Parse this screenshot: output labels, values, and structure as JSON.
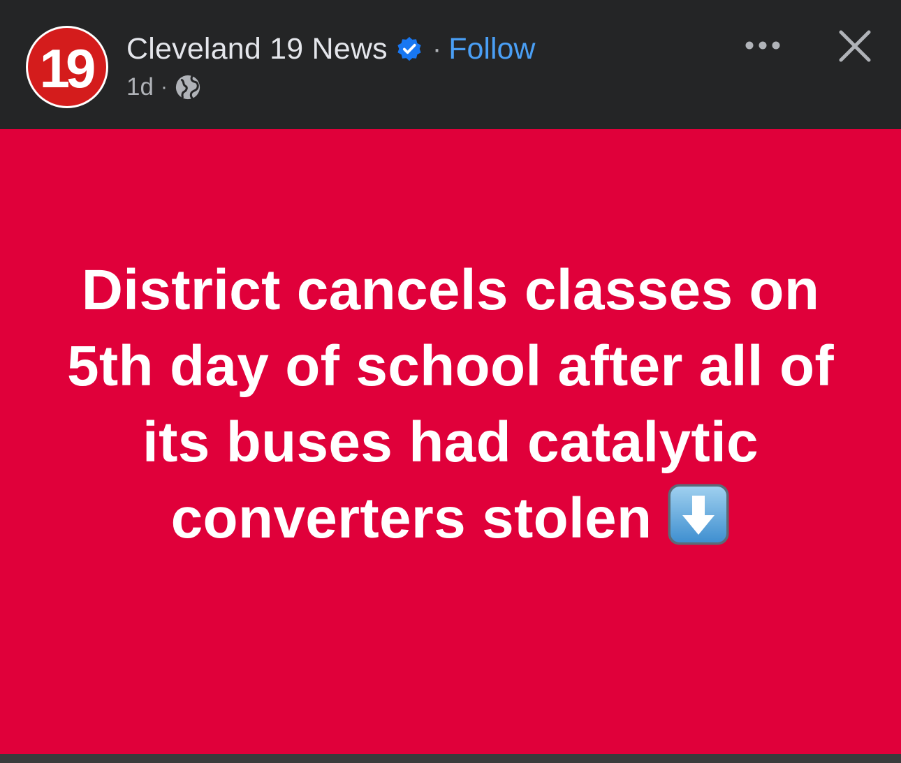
{
  "post": {
    "page_name": "Cleveland 19 News",
    "follow_label": "Follow",
    "separator": "·",
    "timestamp": "1d",
    "meta_separator": "·",
    "avatar_text": "19",
    "icons": {
      "avatar": "station-logo-icon",
      "verified": "verified-badge-icon",
      "privacy": "globe-icon",
      "more": "more-options-icon",
      "close": "close-icon",
      "emoji": "down-arrow-emoji-icon"
    }
  },
  "card": {
    "headline_text": "District cancels classes on 5th day of school after all of its buses had catalytic converters stolen",
    "background_color": "#e0003a"
  },
  "colors": {
    "header_bg": "#242526",
    "follow": "#4a9ff5",
    "verified": "#1877f2"
  }
}
